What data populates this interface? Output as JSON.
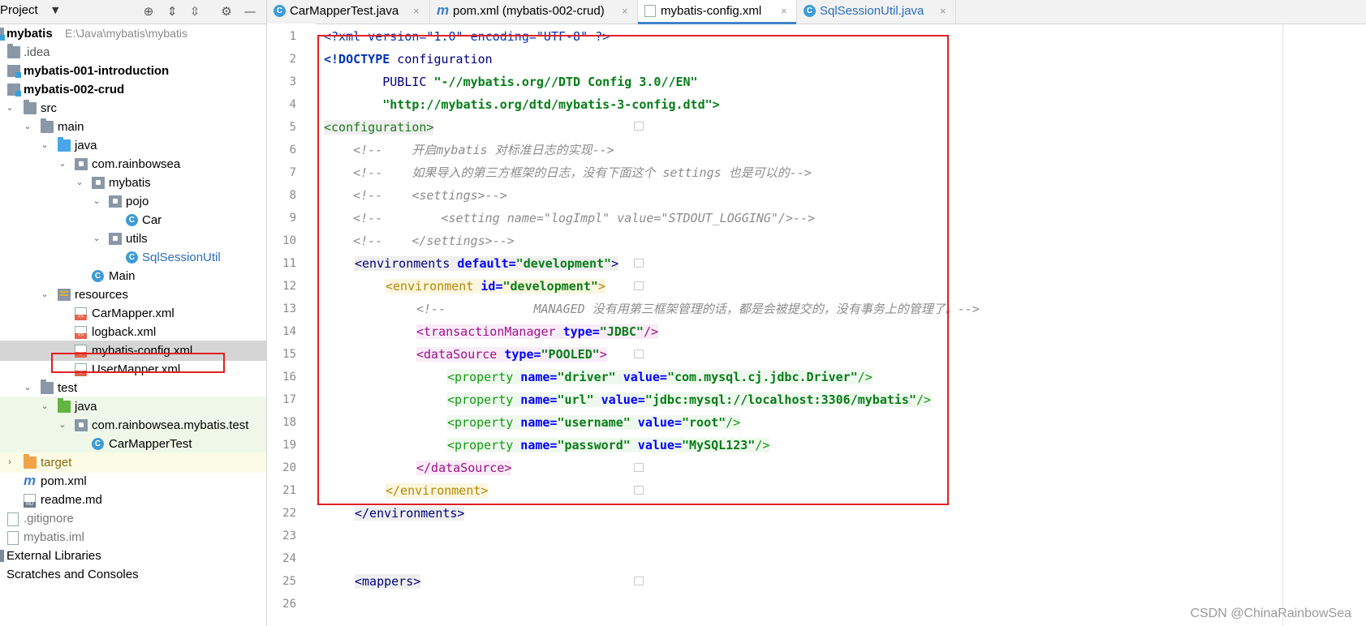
{
  "sidebar": {
    "title": "Project",
    "tree": [
      {
        "label": "mybatis",
        "path": "E:\\Java\\mybatis\\mybatis",
        "bold": true
      },
      {
        "label": ".idea"
      },
      {
        "label": "mybatis-001-introduction",
        "bold": true
      },
      {
        "label": "mybatis-002-crud",
        "bold": true
      },
      {
        "label": "src"
      },
      {
        "label": "main"
      },
      {
        "label": "java"
      },
      {
        "label": "com.rainbowsea"
      },
      {
        "label": "mybatis"
      },
      {
        "label": "pojo"
      },
      {
        "label": "Car"
      },
      {
        "label": "utils"
      },
      {
        "label": "SqlSessionUtil"
      },
      {
        "label": "Main"
      },
      {
        "label": "resources"
      },
      {
        "label": "CarMapper.xml"
      },
      {
        "label": "logback.xml"
      },
      {
        "label": "mybatis-config.xml"
      },
      {
        "label": "UserMapper.xml"
      },
      {
        "label": "test"
      },
      {
        "label": "java"
      },
      {
        "label": "com.rainbowsea.mybatis.test"
      },
      {
        "label": "CarMapperTest"
      },
      {
        "label": "target"
      },
      {
        "label": "pom.xml"
      },
      {
        "label": "readme.md"
      },
      {
        "label": ".gitignore"
      },
      {
        "label": "mybatis.iml"
      },
      {
        "label": "External Libraries"
      },
      {
        "label": "Scratches and Consoles"
      }
    ]
  },
  "tabs": [
    {
      "label": "CarMapperTest.java",
      "icon": "java-class-icon"
    },
    {
      "label": "pom.xml (mybatis-002-crud)",
      "icon": "maven-icon"
    },
    {
      "label": "mybatis-config.xml",
      "icon": "xml-icon",
      "active": true
    },
    {
      "label": "SqlSessionUtil.java",
      "icon": "java-class-icon"
    }
  ],
  "editor": {
    "line_numbers": [
      "1",
      "2",
      "3",
      "4",
      "5",
      "6",
      "7",
      "8",
      "9",
      "10",
      "11",
      "12",
      "13",
      "14",
      "15",
      "16",
      "17",
      "18",
      "19",
      "20",
      "21",
      "22",
      "23",
      "24",
      "25",
      "26"
    ],
    "lines": {
      "l1_a": "<?xml version=\"1.0\" encoding=\"UTF-8\" ?>",
      "l2_a": "<!DOCTYPE",
      "l2_b": " configuration",
      "l3_a": "        PUBLIC",
      "l3_b": " \"-//mybatis.org//DTD Config 3.0//EN\"",
      "l4_a": "        \"http://mybatis.org/dtd/mybatis-3-config.dtd\">",
      "l5_a": "<configuration>",
      "l6": "    <!--    开启mybatis 对标准日志的实现-->",
      "l7": "    <!--    如果导入的第三方框架的日志，没有下面这个 settings 也是可以的-->",
      "l8": "    <!--    <settings>-->",
      "l9": "    <!--        <setting name=\"logImpl\" value=\"STDOUT_LOGGING\"/>-->",
      "l10": "    <!--    </settings>-->",
      "l11_tag": "<environments",
      "l11_attr": " default=",
      "l11_val": "\"development\"",
      "l11_end": ">",
      "l12_tag": "<environment",
      "l12_attr": " id=",
      "l12_val": "\"development\"",
      "l12_end": ">",
      "l13": "<!--            MANAGED 没有用第三框架管理的话，都是会被提交的，没有事务上的管理了。-->",
      "l14_tag": "<transactionManager",
      "l14_attr": " type=",
      "l14_val": "\"JDBC\"",
      "l14_end": "/>",
      "l15_tag": "<dataSource",
      "l15_attr": " type=",
      "l15_val": "\"POOLED\"",
      "l15_end": ">",
      "l16_tag": "<property",
      "l16_a1": " name=",
      "l16_v1": "\"driver\"",
      "l16_a2": " value=",
      "l16_v2": "\"com.mysql.cj.jdbc.Driver\"",
      "l16_end": "/>",
      "l17_tag": "<property",
      "l17_a1": " name=",
      "l17_v1": "\"url\"",
      "l17_a2": " value=",
      "l17_v2": "\"jdbc:mysql://localhost:3306/mybatis\"",
      "l17_end": "/>",
      "l18_tag": "<property",
      "l18_a1": " name=",
      "l18_v1": "\"username\"",
      "l18_a2": " value=",
      "l18_v2": "\"root\"",
      "l18_end": "/>",
      "l19_tag": "<property",
      "l19_a1": " name=",
      "l19_v1": "\"password\"",
      "l19_a2": " value=",
      "l19_v2": "\"MySQL123\"",
      "l19_end": "/>",
      "l20": "</dataSource>",
      "l21": "</environment>",
      "l22": "</environments>",
      "l25": "<mappers>"
    }
  },
  "watermark": "CSDN @ChinaRainbowSea",
  "colors": {
    "highlight_box": "#e02020",
    "active_tab_underline": "#4083c9",
    "selection": "#d5d5d5"
  }
}
